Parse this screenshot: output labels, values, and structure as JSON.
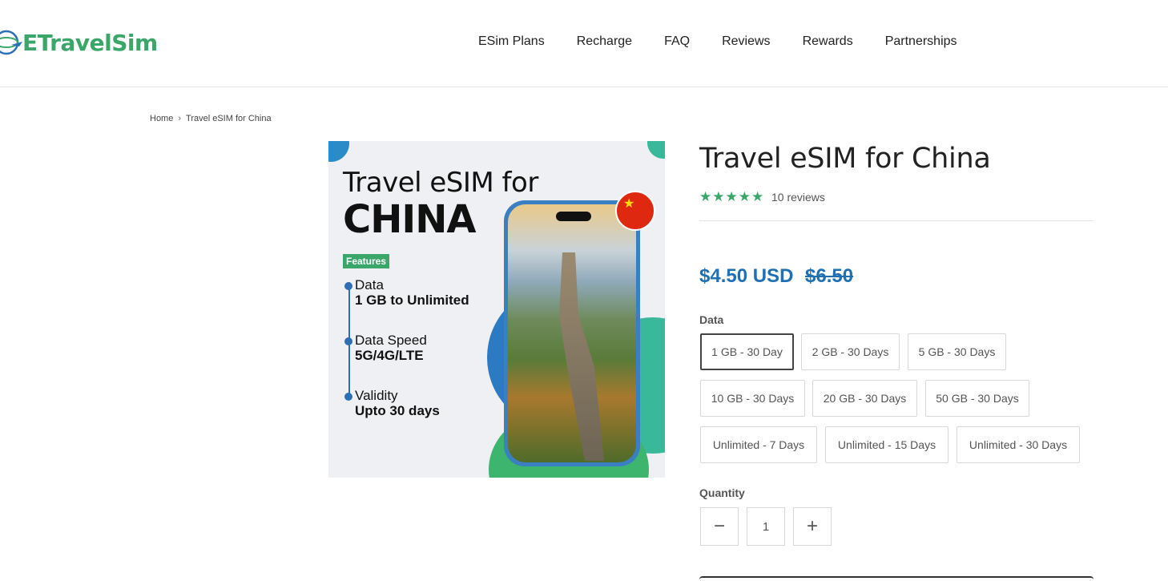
{
  "brand": {
    "name": "ETravelSim",
    "color": "#3aa66a"
  },
  "nav": [
    "ESim Plans",
    "Recharge",
    "FAQ",
    "Reviews",
    "Rewards",
    "Partnerships"
  ],
  "breadcrumb": {
    "home": "Home",
    "current": "Travel eSIM for China"
  },
  "product_image": {
    "title_line1": "Travel eSIM for",
    "title_line2": "CHINA",
    "badge": "Features",
    "features": [
      {
        "label": "Data",
        "value": "1 GB to Unlimited"
      },
      {
        "label": "Data Speed",
        "value": "5G/4G/LTE"
      },
      {
        "label": "Validity",
        "value": "Upto 30 days"
      }
    ]
  },
  "product": {
    "title": "Travel eSIM for China",
    "rating": 5,
    "reviews_text": "10 reviews",
    "price": "$4.50 USD",
    "compare_price": "$6.50",
    "accent": "#1f6fb3"
  },
  "options": {
    "data_label": "Data",
    "selected": "1 GB - 30 Day",
    "variants": [
      "1 GB - 30 Day",
      "2 GB - 30 Days",
      "5 GB - 30 Days",
      "10 GB - 30 Days",
      "20 GB - 30 Days",
      "50 GB - 30 Days",
      "Unlimited - 7 Days",
      "Unlimited - 15 Days",
      "Unlimited - 30 Days"
    ]
  },
  "quantity": {
    "label": "Quantity",
    "value": "1",
    "minus": "−",
    "plus": "+"
  }
}
